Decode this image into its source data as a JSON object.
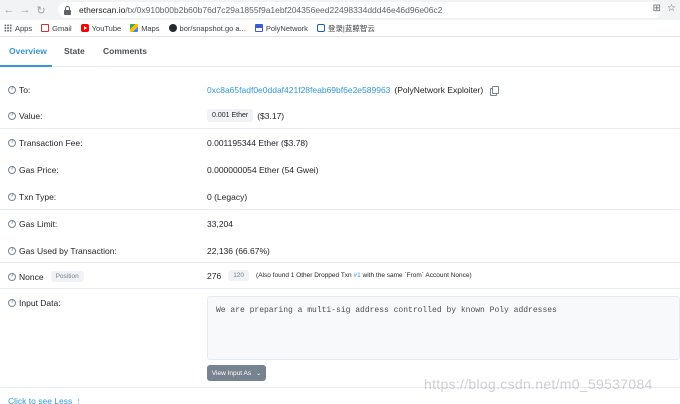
{
  "browser": {
    "url_host": "etherscan.io",
    "url_path": "/tx/0x910b00b2b60b76d7c29a1855f9a1ebf204356eed22498334ddd46e46d96e06c2",
    "bookmarks": [
      {
        "label": "Apps",
        "icon": "apps-icon"
      },
      {
        "label": "Gmail",
        "icon": "gmail-icon"
      },
      {
        "label": "YouTube",
        "icon": "youtube-icon"
      },
      {
        "label": "Maps",
        "icon": "maps-icon"
      },
      {
        "label": "bor/snapshot.go a...",
        "icon": "github-icon"
      },
      {
        "label": "PolyNetwork",
        "icon": "polynetwork-icon"
      },
      {
        "label": "登录|蓝鲸智云",
        "icon": "cloud-icon"
      }
    ]
  },
  "tabs": [
    {
      "label": "Overview",
      "active": true
    },
    {
      "label": "State",
      "active": false
    },
    {
      "label": "Comments",
      "active": false
    }
  ],
  "fields": {
    "to_label": "To:",
    "to_address": "0xc8a65fadf0e0ddaf421f28feab69bf6e2e589963",
    "to_name": "(PolyNetwork Exploiter)",
    "value_label": "Value:",
    "value_badge": "0.001 Ether",
    "value_usd": "($3.17)",
    "fee_label": "Transaction Fee:",
    "fee_value": "0.001195344 Ether ($3.78)",
    "gas_price_label": "Gas Price:",
    "gas_price_value": "0.000000054 Ether (54 Gwei)",
    "txn_type_label": "Txn Type:",
    "txn_type_value": "0 (Legacy)",
    "gas_limit_label": "Gas Limit:",
    "gas_limit_value": "33,204",
    "gas_used_label": "Gas Used by Transaction:",
    "gas_used_value": "22,136 (66.67%)",
    "nonce_label": "Nonce",
    "nonce_badge": "Position",
    "nonce_value": "276",
    "position_value": "120",
    "nonce_note_prefix": "(Also found 1 Other Dropped Txn",
    "nonce_note_link": "#1",
    "nonce_note_suffix": "with the same `From` Account Nonce)",
    "input_label": "Input Data:",
    "input_text": "We are preparing a multi-sig address controlled by known Poly addresses",
    "view_input_button": "View Input As"
  },
  "footer": {
    "click_less": "Click to see Less",
    "watermark": "https://blog.csdn.net/m0_59537084"
  },
  "colors": {
    "accent": "#3498db",
    "text": "#1e2022",
    "muted": "#77838f"
  }
}
